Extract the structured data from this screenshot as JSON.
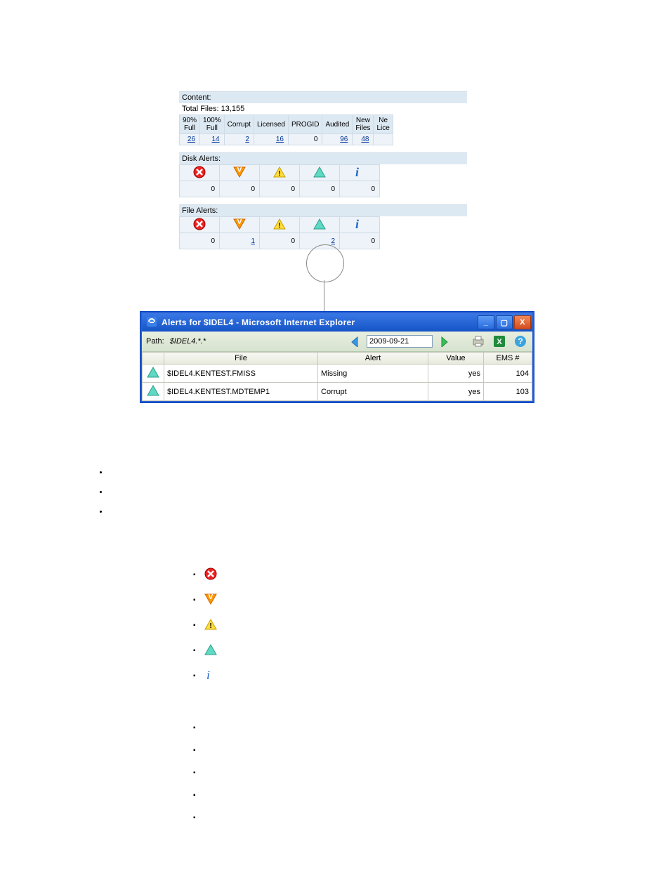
{
  "content": {
    "header": "Content:",
    "total_label": "Total Files: 13,155",
    "columns": [
      "90% Full",
      "100% Full",
      "Corrupt",
      "Licensed",
      "PROGID",
      "Audited",
      "New Files",
      "Ne Lice"
    ],
    "values": [
      "26",
      "14",
      "2",
      "16",
      "0",
      "96",
      "48",
      ""
    ],
    "value_link": [
      true,
      true,
      true,
      true,
      false,
      true,
      true,
      false
    ]
  },
  "disk_alerts": {
    "header": "Disk Alerts:",
    "values": [
      "0",
      "0",
      "0",
      "0",
      "0"
    ],
    "value_link": [
      false,
      false,
      false,
      false,
      false
    ]
  },
  "file_alerts": {
    "header": "File Alerts:",
    "values": [
      "0",
      "1",
      "0",
      "2",
      "0"
    ],
    "value_link": [
      false,
      true,
      false,
      true,
      false
    ]
  },
  "severity_icons": [
    "critical",
    "major",
    "minor",
    "warning",
    "info"
  ],
  "ie_window": {
    "title": "Alerts for $IDEL4 - Microsoft Internet Explorer",
    "path_label": "Path: ",
    "path_value": "$IDEL4.*.*",
    "date": "2009-09-21",
    "columns": [
      "",
      "File",
      "Alert",
      "Value",
      "EMS #"
    ],
    "rows": [
      {
        "icon": "warning",
        "file": "$IDEL4.KENTEST.FMISS",
        "alert": "Missing",
        "value": "yes",
        "ems": "104"
      },
      {
        "icon": "warning",
        "file": "$IDEL4.KENTEST.MDTEMP1",
        "alert": "Corrupt",
        "value": "yes",
        "ems": "103"
      }
    ]
  }
}
